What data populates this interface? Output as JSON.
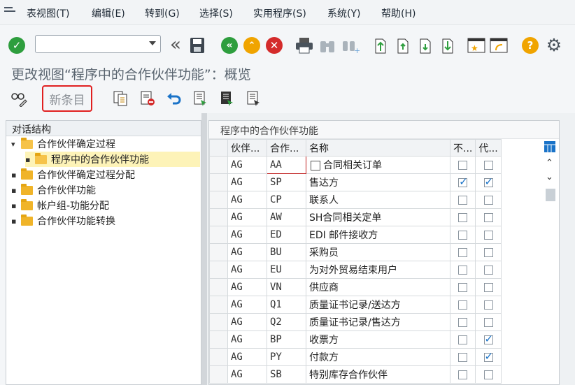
{
  "menu": {
    "items": [
      "表视图(T)",
      "编辑(E)",
      "转到(G)",
      "选择(S)",
      "实用程序(S)",
      "系统(Y)",
      "帮助(H)"
    ]
  },
  "command_field": {
    "value": ""
  },
  "title": "更改视图“程序中的合作伙伴功能”：概览",
  "app_toolbar": {
    "new_entries": "新条目"
  },
  "tree": {
    "header": "对话结构",
    "items": [
      "合作伙伴确定过程",
      "程序中的合作伙伴功能",
      "合作伙伴确定过程分配",
      "合作伙伴功能",
      "帐户组-功能分配",
      "合作伙伴功能转换"
    ]
  },
  "table": {
    "caption": "程序中的合作伙伴功能",
    "columns": [
      "伙伴...",
      "合作...",
      "名称",
      "不...",
      "代..."
    ],
    "rows": [
      {
        "proc": "AG",
        "func": "AA",
        "name": "合同相关订单",
        "c1": false,
        "c2": false
      },
      {
        "proc": "AG",
        "func": "SP",
        "name": "售达方",
        "c1": true,
        "c2": true
      },
      {
        "proc": "AG",
        "func": "CP",
        "name": "联系人",
        "c1": false,
        "c2": false
      },
      {
        "proc": "AG",
        "func": "AW",
        "name": "SH合同相关定单",
        "c1": false,
        "c2": false
      },
      {
        "proc": "AG",
        "func": "ED",
        "name": "EDI 邮件接收方",
        "c1": false,
        "c2": false
      },
      {
        "proc": "AG",
        "func": "BU",
        "name": "采购员",
        "c1": false,
        "c2": false
      },
      {
        "proc": "AG",
        "func": "EU",
        "name": "为对外贸易结束用户",
        "c1": false,
        "c2": false
      },
      {
        "proc": "AG",
        "func": "VN",
        "name": "供应商",
        "c1": false,
        "c2": false
      },
      {
        "proc": "AG",
        "func": "Q1",
        "name": "质量证书记录/送达方",
        "c1": false,
        "c2": false
      },
      {
        "proc": "AG",
        "func": "Q2",
        "name": "质量证书记录/售达方",
        "c1": false,
        "c2": false
      },
      {
        "proc": "AG",
        "func": "BP",
        "name": "收票方",
        "c1": false,
        "c2": true
      },
      {
        "proc": "AG",
        "func": "PY",
        "name": "付款方",
        "c1": false,
        "c2": true
      },
      {
        "proc": "AG",
        "func": "SB",
        "name": "特别库存合作伙伴",
        "c1": false,
        "c2": false
      }
    ]
  },
  "colors": {
    "accent": "#1a73c8",
    "highlight": "#e02020"
  }
}
